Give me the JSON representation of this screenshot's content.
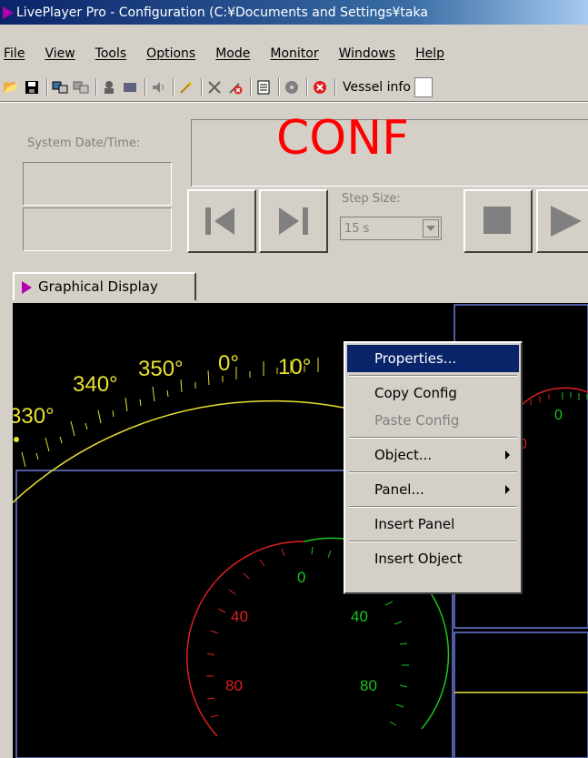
{
  "titlebar": {
    "title": "LivePlayer Pro - Configuration (C:¥Documents and Settings¥taka"
  },
  "menu": [
    "File",
    "View",
    "Tools",
    "Options",
    "Mode",
    "Monitor",
    "Windows",
    "Help"
  ],
  "toolbar": {
    "vessel_label": "Vessel info"
  },
  "left_panel": {
    "system_datetime_label": "System Date/Time:",
    "datetime_value_1": "",
    "datetime_value_2": ""
  },
  "banner": {
    "text": "CONF"
  },
  "playback": {
    "step_size_label": "Step Size:",
    "step_size_value": "15 s"
  },
  "tab": {
    "label": "Graphical Display"
  },
  "compass": {
    "labels": [
      "330°",
      "340°",
      "350°",
      "0°",
      "10°"
    ],
    "color": "#e8e030"
  },
  "gauge_left": {
    "labels_red": [
      "40",
      "80"
    ],
    "labels_green": [
      "0",
      "40",
      "80"
    ],
    "red": "#dd1f1f",
    "green": "#19c51f"
  },
  "gauge_right": {
    "labels_green": [
      "0"
    ],
    "labels_red": [
      "0"
    ]
  },
  "context_menu": {
    "items": [
      {
        "label": "Properties...",
        "state": "active",
        "submenu": false
      },
      {
        "sep": true
      },
      {
        "label": "Copy Config",
        "state": "normal",
        "submenu": false
      },
      {
        "label": "Paste Config",
        "state": "disabled",
        "submenu": false
      },
      {
        "sep": true
      },
      {
        "label": "Object...",
        "state": "normal",
        "submenu": true
      },
      {
        "sep": true
      },
      {
        "label": "Panel...",
        "state": "normal",
        "submenu": true
      },
      {
        "sep": true
      },
      {
        "label": "Insert Panel",
        "state": "normal",
        "submenu": false
      },
      {
        "sep": true
      },
      {
        "label": "Insert Object",
        "state": "normal",
        "submenu": false
      }
    ]
  }
}
